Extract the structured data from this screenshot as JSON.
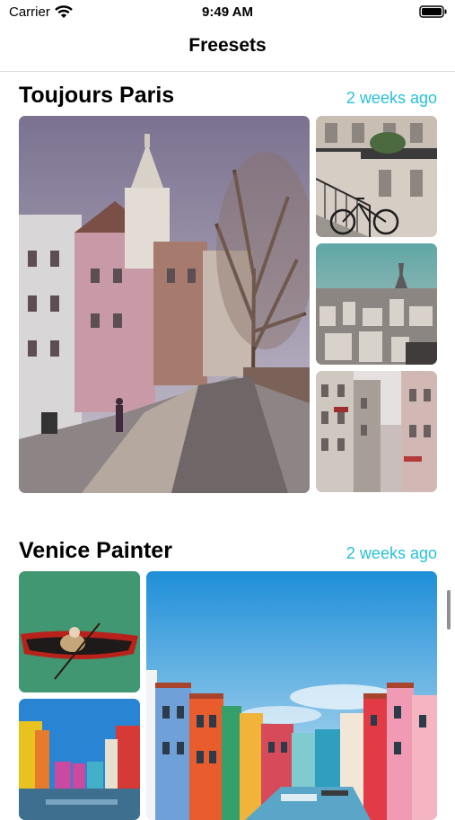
{
  "status_bar": {
    "carrier": "Carrier",
    "time": "9:49 AM"
  },
  "nav": {
    "title": "Freesets"
  },
  "sections": [
    {
      "title": "Toujours Paris",
      "time": "2 weeks ago",
      "photos": [
        "montmartre-street-photo",
        "paris-balcony-bicycles-photo",
        "paris-eiffel-skyline-photo",
        "paris-narrow-street-photo"
      ]
    },
    {
      "title": "Venice Painter",
      "time": "2 weeks ago",
      "photos": [
        "gondola-green-water-photo",
        "burano-canal-photo",
        "burano-colorful-houses-photo"
      ]
    }
  ],
  "colors": {
    "accent": "#29c1d6"
  }
}
